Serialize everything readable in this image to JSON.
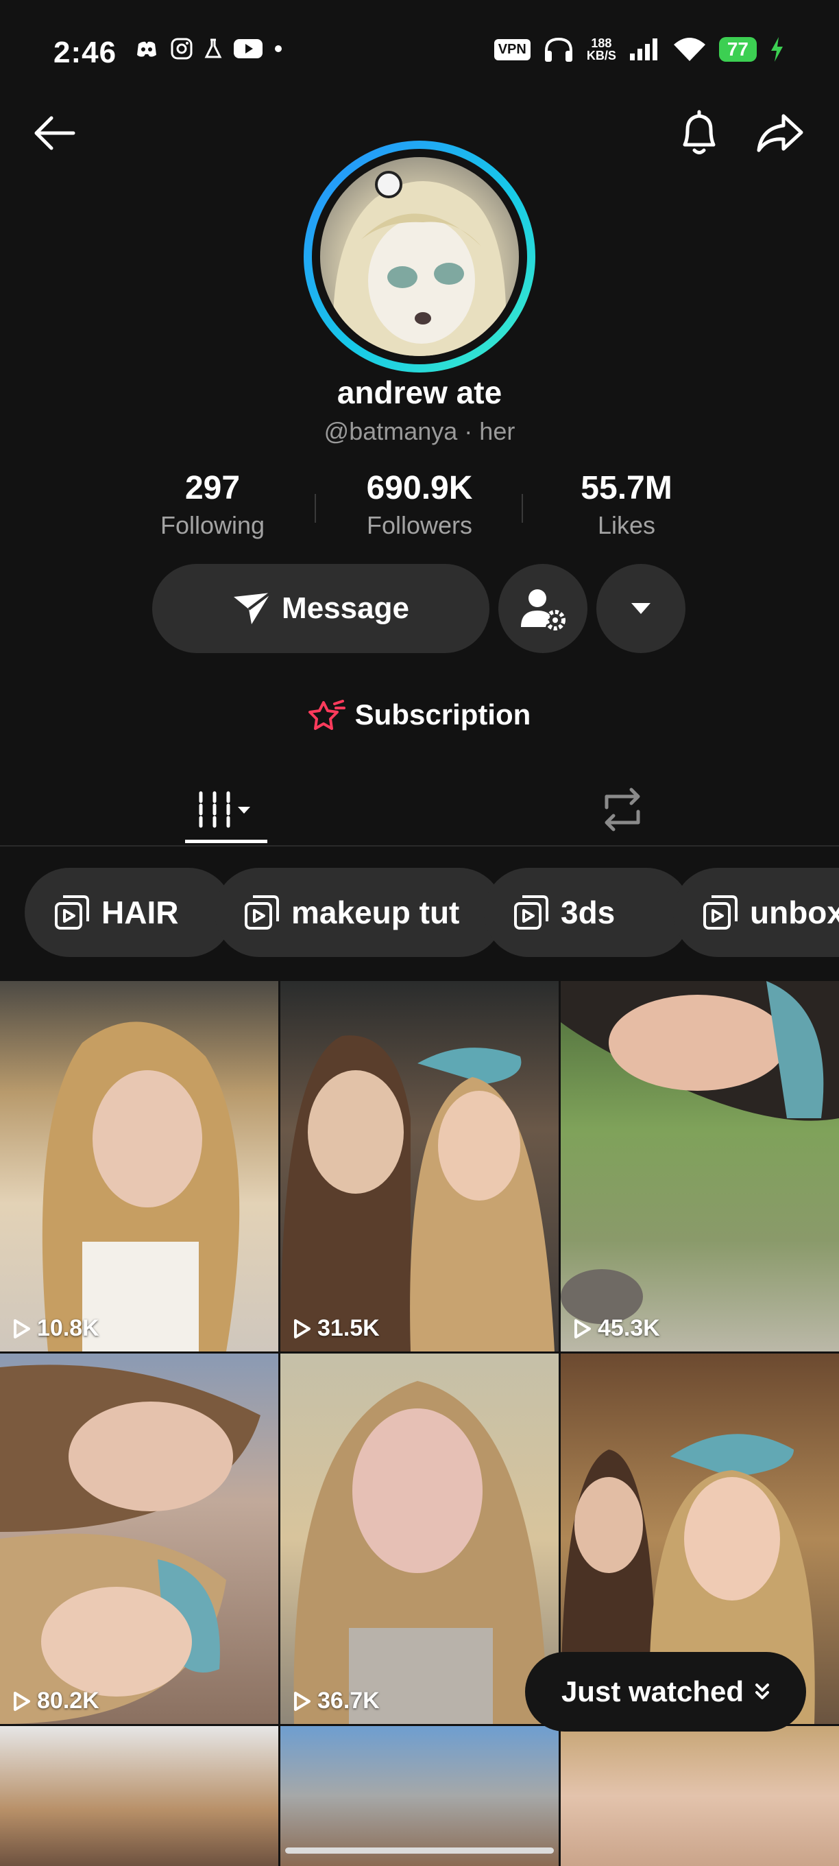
{
  "status_bar": {
    "time": "2:46",
    "vpn": "VPN",
    "speed_value": "188",
    "speed_unit": "KB/S",
    "battery": "77"
  },
  "profile": {
    "display_name": "andrew ate",
    "handle_line": "@batmanya · her",
    "stats": [
      {
        "value": "297",
        "label": "Following"
      },
      {
        "value": "690.9K",
        "label": "Followers"
      },
      {
        "value": "55.7M",
        "label": "Likes"
      }
    ]
  },
  "actions": {
    "message_label": "Message",
    "subscription_label": "Subscription"
  },
  "playlists": [
    "HAIR",
    "makeup tut",
    "3ds",
    "unboxi"
  ],
  "videos": [
    {
      "views": "10.8K"
    },
    {
      "views": "31.5K"
    },
    {
      "views": "45.3K"
    },
    {
      "views": "80.2K"
    },
    {
      "views": "36.7K"
    },
    {
      "views": ""
    }
  ],
  "just_watched_label": "Just watched",
  "colors": {
    "background": "#121212",
    "button": "#2e2e2e",
    "avatar_ring": "#17c9e8",
    "subscription_icon": "#ff3b5c",
    "battery": "#3ccf52"
  },
  "icons": [
    "back-arrow-icon",
    "bell-icon",
    "share-icon",
    "send-icon",
    "person-settings-icon",
    "chevron-down-icon",
    "subscription-star-icon",
    "grid-icon",
    "repost-icon",
    "playlist-icon",
    "play-icon"
  ]
}
